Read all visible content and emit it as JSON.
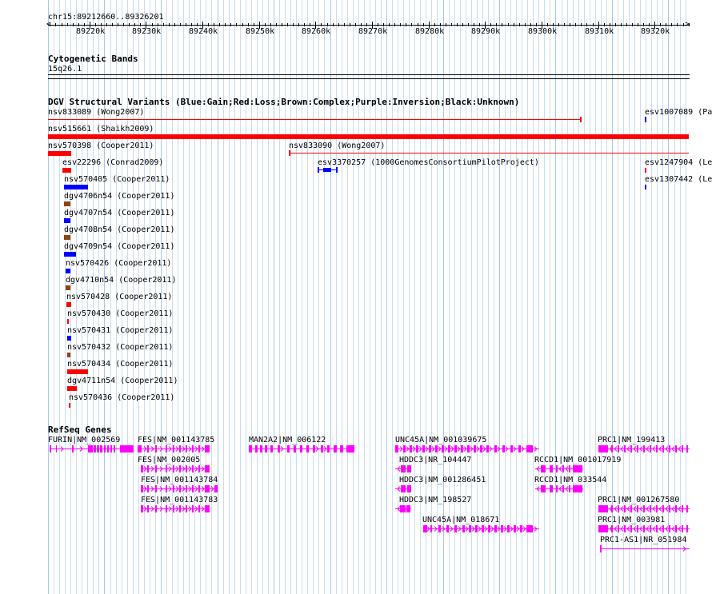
{
  "ruler": {
    "coord_label": "chr15:89212660..89326201",
    "ticks": [
      "89220k",
      "89230k",
      "89240k",
      "89250k",
      "89260k",
      "89270k",
      "89280k",
      "89290k",
      "89300k",
      "89310k",
      "89320k"
    ]
  },
  "cytoband": {
    "title": "Cytogenetic Bands",
    "band": "15q26.1"
  },
  "dgv": {
    "title": "DGV Structural Variants (Blue:Gain;Red:Loss;Brown:Complex;Purple:Inversion;Black:Unknown)",
    "colors": {
      "gain": "#0000ff",
      "loss": "#ff0000",
      "complex": "#8b4513",
      "inversion": "#800080",
      "unknown": "#000000"
    },
    "items": [
      {
        "label": "nsv833089 (Wong2007)",
        "type": "loss"
      },
      {
        "label": "esv1007089 (Pa",
        "type": "gain"
      },
      {
        "label": "nsv515661 (Shaikh2009)",
        "type": "loss"
      },
      {
        "label": "nsv570398 (Cooper2011)",
        "type": "loss"
      },
      {
        "label": "nsv833090 (Wong2007)",
        "type": "loss"
      },
      {
        "label": "esv22296 (Conrad2009)",
        "type": "loss"
      },
      {
        "label": "esv3370257 (1000GenomesConsortiumPilotProject)",
        "type": "gain"
      },
      {
        "label": "esv1247904 (Le",
        "type": "loss"
      },
      {
        "label": "esv1307442 (Le",
        "type": "gain"
      },
      {
        "label": "nsv570405 (Cooper2011)",
        "type": "gain"
      },
      {
        "label": "dgv4706n54 (Cooper2011)",
        "type": "complex"
      },
      {
        "label": "dgv4707n54 (Cooper2011)",
        "type": "gain"
      },
      {
        "label": "dgv4708n54 (Cooper2011)",
        "type": "complex"
      },
      {
        "label": "dgv4709n54 (Cooper2011)",
        "type": "gain"
      },
      {
        "label": "nsv570426 (Cooper2011)",
        "type": "gain"
      },
      {
        "label": "dgv4710n54 (Cooper2011)",
        "type": "complex"
      },
      {
        "label": "nsv570428 (Cooper2011)",
        "type": "loss"
      },
      {
        "label": "nsv570430 (Cooper2011)",
        "type": "loss"
      },
      {
        "label": "nsv570431 (Cooper2011)",
        "type": "gain"
      },
      {
        "label": "nsv570432 (Cooper2011)",
        "type": "complex"
      },
      {
        "label": "nsv570434 (Cooper2011)",
        "type": "loss"
      },
      {
        "label": "dgv4711n54 (Cooper2011)",
        "type": "loss"
      },
      {
        "label": "nsv570436 (Cooper2011)",
        "type": "loss"
      }
    ]
  },
  "refseq": {
    "title": "RefSeq Genes",
    "color": "#ff00ff",
    "genes": [
      {
        "label": "FURIN|NM_002569"
      },
      {
        "label": "FES|NM_001143785"
      },
      {
        "label": "FES|NM_002005"
      },
      {
        "label": "FES|NM_001143784"
      },
      {
        "label": "FES|NM_001143783"
      },
      {
        "label": "MAN2A2|NM_006122"
      },
      {
        "label": "UNC45A|NM_001039675"
      },
      {
        "label": "HDDC3|NR_104447"
      },
      {
        "label": "HDDC3|NM_001286451"
      },
      {
        "label": "HDDC3|NM_198527"
      },
      {
        "label": "UNC45A|NM_018671"
      },
      {
        "label": "RCCD1|NM_001017919"
      },
      {
        "label": "RCCD1|NM_033544"
      },
      {
        "label": "PRC1|NM_199413"
      },
      {
        "label": "PRC1|NM_001267580"
      },
      {
        "label": "PRC1|NM_003981"
      },
      {
        "label": "PRC1-AS1|NR_051984"
      }
    ]
  }
}
